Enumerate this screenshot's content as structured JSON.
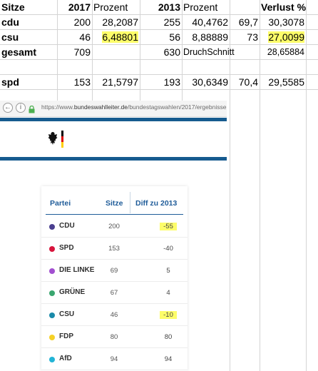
{
  "sheet": {
    "rows": [
      {
        "a": "Sitze",
        "b": "2017",
        "c": "Prozent",
        "d": "2013",
        "e": "Prozent",
        "f": "",
        "g": "Verlust %",
        "h": ""
      },
      {
        "a": "cdu",
        "b": "200",
        "c": "28,2087",
        "d": "255",
        "e": "40,4762",
        "f": "69,7",
        "g": "30,3078",
        "h": ""
      },
      {
        "a": "csu",
        "b": "46",
        "c": "6,48801",
        "d": "56",
        "e": "8,88889",
        "f": "73",
        "g": "27,0099",
        "h": ""
      },
      {
        "a": "gesamt",
        "b": "709",
        "c": "",
        "d": "630",
        "e": "DruchSchnitt",
        "f": "",
        "g": "28,65884",
        "h": ""
      },
      {
        "a": "",
        "b": "",
        "c": "",
        "d": "",
        "e": "",
        "f": "",
        "g": "",
        "h": ""
      },
      {
        "a": "spd",
        "b": "153",
        "c": "21,5797",
        "d": "193",
        "e": "30,6349",
        "f": "70,4",
        "g": "29,5585",
        "h": ""
      }
    ]
  },
  "browser": {
    "url_prefix": "https://www.",
    "url_domain": "bundeswahlleiter.de",
    "url_path": "/bundestagswahlen/2017/ergebnisse",
    "icons": [
      "back-icon",
      "info-icon",
      "lock-icon"
    ],
    "table": {
      "headers": {
        "party": "Partei",
        "seats": "Sitze",
        "diff": "Diff zu 2013"
      },
      "rows": [
        {
          "party": "CDU",
          "color": "#4a3f8f",
          "seats": "200",
          "diff": "-55",
          "highlight": true
        },
        {
          "party": "SPD",
          "color": "#d8143c",
          "seats": "153",
          "diff": "-40",
          "highlight": false
        },
        {
          "party": "DIE LINKE",
          "color": "#a24fd0",
          "seats": "69",
          "diff": "5",
          "highlight": false
        },
        {
          "party": "GRÜNE",
          "color": "#3aa66f",
          "seats": "67",
          "diff": "4",
          "highlight": false
        },
        {
          "party": "CSU",
          "color": "#1a8aa9",
          "seats": "46",
          "diff": "-10",
          "highlight": true
        },
        {
          "party": "FDP",
          "color": "#f5d127",
          "seats": "80",
          "diff": "80",
          "highlight": false
        },
        {
          "party": "AfD",
          "color": "#22b4d6",
          "seats": "94",
          "diff": "94",
          "highlight": false
        }
      ]
    }
  },
  "colors": {
    "highlight": "#fdfd6a",
    "header_blue": "#1f5c99",
    "bar_blue": "#165b8f"
  }
}
